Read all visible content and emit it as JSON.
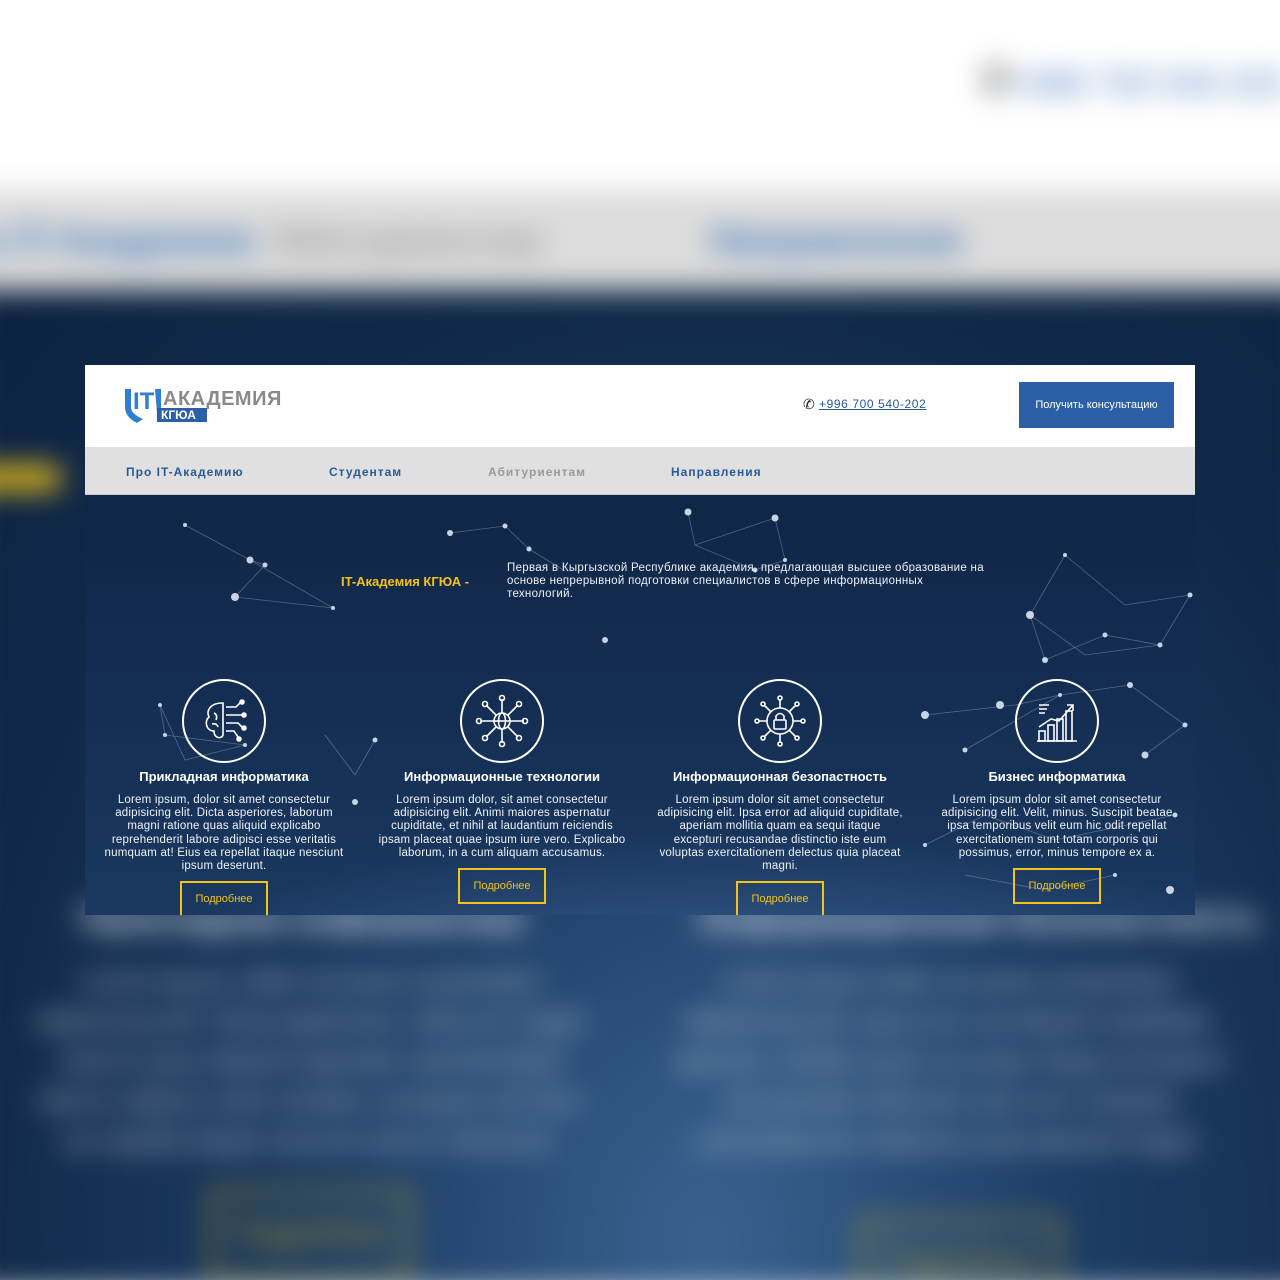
{
  "site": {
    "logo": {
      "main": "АКАДЕМИЯ",
      "it": "IT",
      "sub": "КГЮА"
    },
    "phone": "+996 700 540-202",
    "consult_button": "Получить консультацию"
  },
  "nav": {
    "items": [
      {
        "label": "Про IT-Академию",
        "color": "#2a5a9a"
      },
      {
        "label": "Студентам",
        "color": "#2a5a9a"
      },
      {
        "label": "Абитуриентам",
        "color": "#9a9a9a"
      },
      {
        "label": "Направления",
        "color": "#2a5a9a"
      }
    ]
  },
  "hero": {
    "label": "IT-Академия КГЮА -",
    "text": "Первая в Кыргызской Республике академия, предлагающая высшее образование на основе непрерывной подготовки специалистов в сфере информационных технологий."
  },
  "features": [
    {
      "icon": "brain-circuit-icon",
      "title": "Прикладная информатика",
      "text": "Lorem ipsum, dolor sit amet consectetur adipisicing elit. Dicta asperiores, laborum magni ratione quas aliquid explicabo reprehenderit labore adipisci esse veritatis numquam at! Eius ea repellat itaque nesciunt ipsum deserunt.",
      "button": "Подробнее"
    },
    {
      "icon": "globe-network-icon",
      "title": "Информационные технологии",
      "text": "Lorem ipsum dolor, sit amet consectetur adipisicing elit. Animi maiores aspernatur cupiditate, et nihil at laudantium reiciendis ipsam placeat quae ipsum iure vero. Explicabo laborum, in a cum aliquam accusamus.",
      "button": "Подробнее"
    },
    {
      "icon": "lock-circuit-icon",
      "title": "Информационная безопастность",
      "text": "Lorem ipsum dolor sit amet consectetur adipisicing elit. Ipsa error ad aliquid cupiditate, aperiam mollitia quam ea sequi itaque excepturi recusandae distinctio iste eum voluptas exercitationem delectus quia placeat magni.",
      "button": "Подробнее"
    },
    {
      "icon": "growth-chart-icon",
      "title": "Бизнес информатика",
      "text": "Lorem ipsum dolor sit amet consectetur adipisicing elit. Velit, minus. Suscipit beatae ipsa temporibus velit eum hic odit repellat exercitationem sunt totam corporis qui possimus, error, minus tempore ex a.",
      "button": "Подробнее"
    }
  ],
  "colors": {
    "accent_yellow": "#f2c417",
    "brand_blue": "#2c5fa6",
    "hero_dark": "#12294a"
  }
}
